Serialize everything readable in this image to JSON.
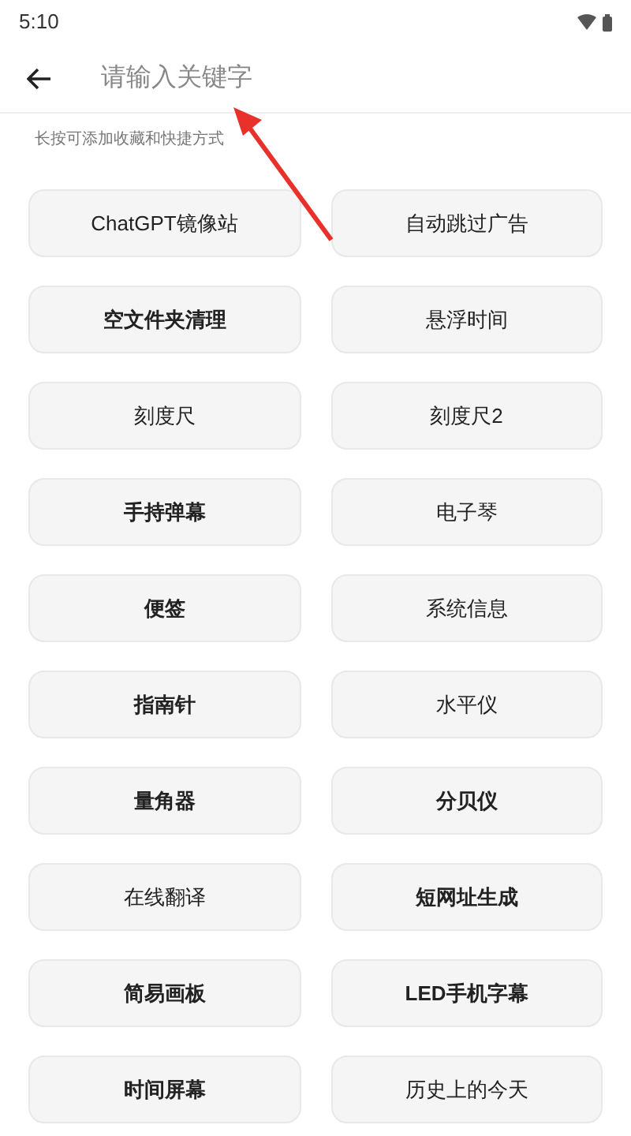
{
  "status_bar": {
    "time": "5:10"
  },
  "search": {
    "placeholder": "请输入关键字"
  },
  "hint": "长按可添加收藏和快捷方式",
  "tools": [
    {
      "label": "ChatGPT镜像站",
      "bold": false
    },
    {
      "label": "自动跳过广告",
      "bold": false
    },
    {
      "label": "空文件夹清理",
      "bold": true
    },
    {
      "label": "悬浮时间",
      "bold": false
    },
    {
      "label": "刻度尺",
      "bold": false
    },
    {
      "label": "刻度尺2",
      "bold": false
    },
    {
      "label": "手持弹幕",
      "bold": true
    },
    {
      "label": "电子琴",
      "bold": false
    },
    {
      "label": "便签",
      "bold": true
    },
    {
      "label": "系统信息",
      "bold": false
    },
    {
      "label": "指南针",
      "bold": true
    },
    {
      "label": "水平仪",
      "bold": false
    },
    {
      "label": "量角器",
      "bold": true
    },
    {
      "label": "分贝仪",
      "bold": true
    },
    {
      "label": "在线翻译",
      "bold": false
    },
    {
      "label": "短网址生成",
      "bold": true
    },
    {
      "label": "简易画板",
      "bold": true
    },
    {
      "label": "LED手机字幕",
      "bold": true
    },
    {
      "label": "时间屏幕",
      "bold": true
    },
    {
      "label": "历史上的今天",
      "bold": false
    }
  ]
}
